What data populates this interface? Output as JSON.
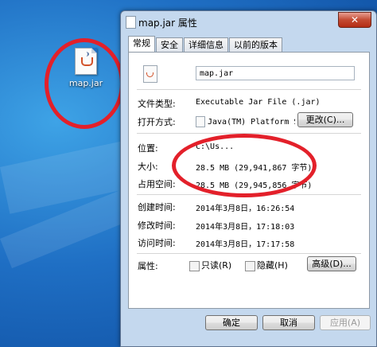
{
  "desktop": {
    "icon_label": "map.jar"
  },
  "window": {
    "title": "map.jar 属性",
    "close_glyph": "✕",
    "tabs": [
      "常规",
      "安全",
      "详细信息",
      "以前的版本"
    ],
    "active_tab": "常规"
  },
  "general": {
    "filename": "map.jar",
    "file_type_label": "文件类型:",
    "file_type_value": "Executable Jar File (.jar)",
    "open_with_label": "打开方式:",
    "open_with_value": "Java(TM) Platform S",
    "change_button": "更改(C)...",
    "location_label": "位置:",
    "location_value": "C:\\Us...",
    "size_label": "大小:",
    "size_value": "28.5 MB (29,941,867 字节)",
    "size_on_disk_label": "占用空间:",
    "size_on_disk_value": "28.5 MB (29,945,856 字节)",
    "created_label": "创建时间:",
    "created_value": "2014年3月8日，16:26:54",
    "modified_label": "修改时间:",
    "modified_value": "2014年3月8日，17:18:03",
    "accessed_label": "访问时间:",
    "accessed_value": "2014年3月8日，17:17:58",
    "attributes_label": "属性:",
    "readonly_label": "只读(R)",
    "hidden_label": "隐藏(H)",
    "advanced_button": "高级(D)..."
  },
  "footer": {
    "ok": "确定",
    "cancel": "取消",
    "apply": "应用(A)"
  }
}
